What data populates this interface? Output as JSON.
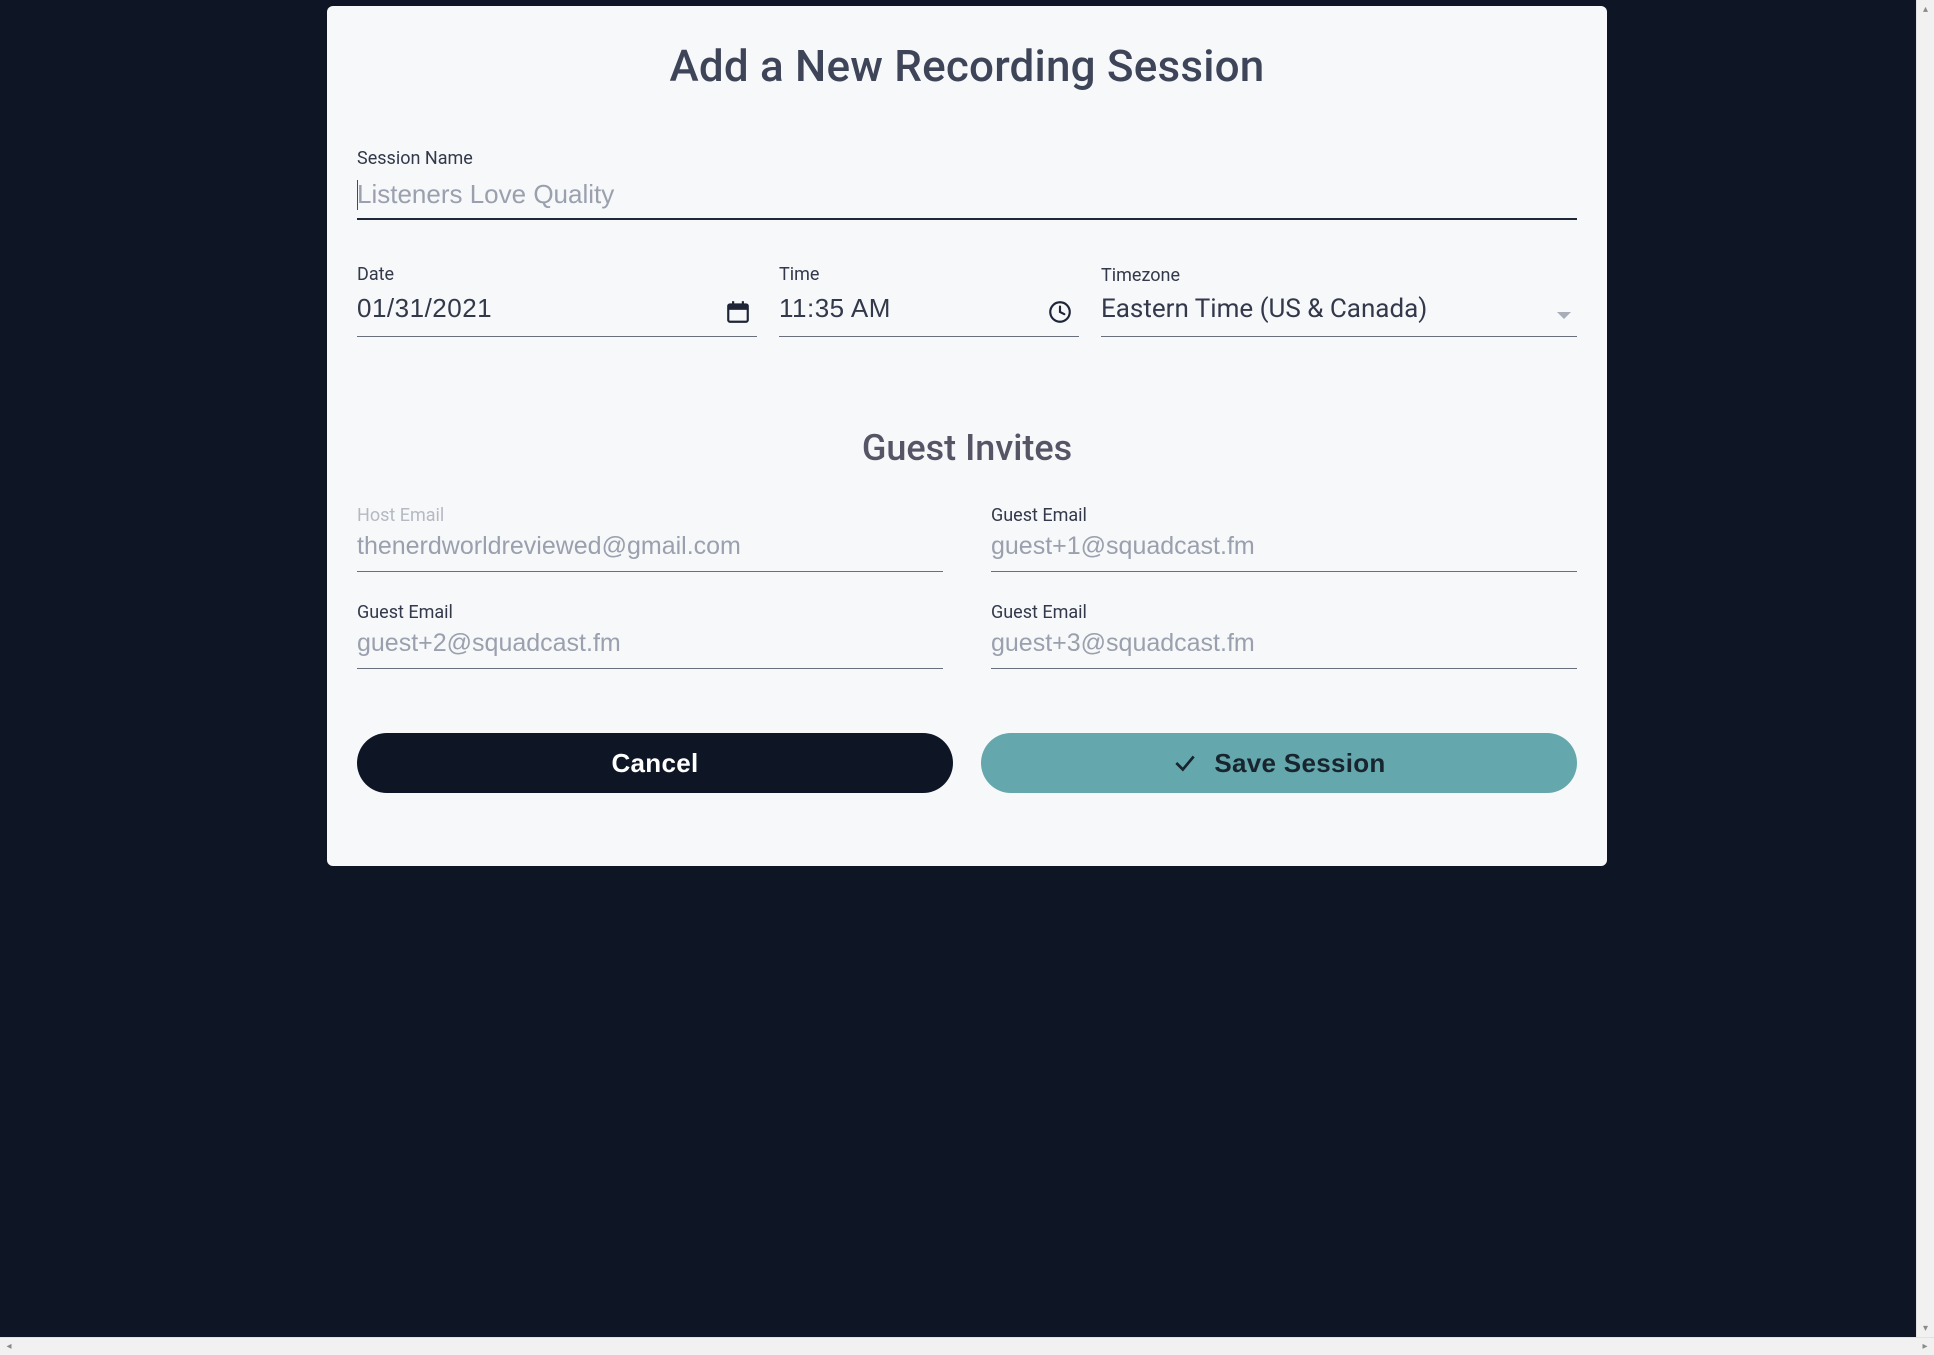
{
  "modal": {
    "title": "Add a New Recording Session"
  },
  "session_name": {
    "label": "Session Name",
    "value": "",
    "placeholder": "Listeners Love Quality"
  },
  "date": {
    "label": "Date",
    "value": "01/31/2021"
  },
  "time": {
    "label": "Time",
    "value": "11:35 AM"
  },
  "timezone": {
    "label": "Timezone",
    "selected": "Eastern Time (US & Canada)"
  },
  "guests": {
    "heading": "Guest Invites",
    "host": {
      "label": "Host Email",
      "value": "thenerdworldreviewed@gmail.com"
    },
    "guest1": {
      "label": "Guest Email",
      "placeholder": "guest+1@squadcast.fm",
      "value": ""
    },
    "guest2": {
      "label": "Guest Email",
      "placeholder": "guest+2@squadcast.fm",
      "value": ""
    },
    "guest3": {
      "label": "Guest Email",
      "placeholder": "guest+3@squadcast.fm",
      "value": ""
    }
  },
  "buttons": {
    "cancel": "Cancel",
    "save": "Save Session"
  }
}
